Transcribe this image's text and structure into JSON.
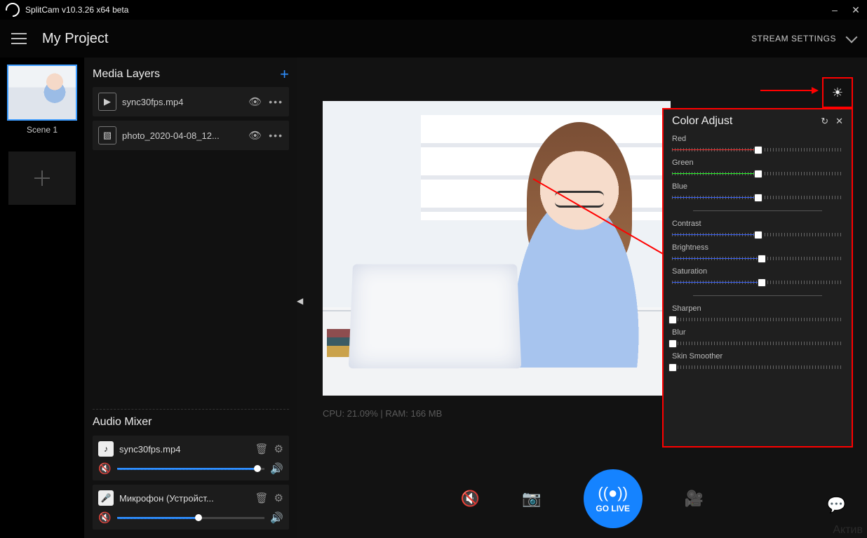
{
  "app": {
    "title": "SplitCam v10.3.26 x64 beta"
  },
  "header": {
    "project_name": "My Project",
    "stream_settings": "STREAM SETTINGS"
  },
  "scenes": {
    "item1_label": "Scene 1"
  },
  "layers": {
    "title": "Media Layers",
    "items": [
      {
        "name": "sync30fps.mp4",
        "icon": "▶"
      },
      {
        "name": "photo_2020-04-08_12...",
        "icon": "▧"
      }
    ]
  },
  "mixer": {
    "title": "Audio Mixer",
    "items": [
      {
        "name": "sync30fps.mp4",
        "vol_percent": 95
      },
      {
        "name": "Микрофон (Устройст...",
        "vol_percent": 55
      }
    ]
  },
  "stats": {
    "text": "CPU: 21.09% | RAM: 166 MB"
  },
  "golive": {
    "label": "GO LIVE"
  },
  "adjust": {
    "title": "Color Adjust",
    "sliders": {
      "red": {
        "label": "Red",
        "pos": 50,
        "color": "#ff2a2a"
      },
      "green": {
        "label": "Green",
        "pos": 50,
        "color": "#29ff29"
      },
      "blue": {
        "label": "Blue",
        "pos": 50,
        "color": "#3a63ff"
      },
      "contrast": {
        "label": "Contrast",
        "pos": 50,
        "color": "#3a63ff"
      },
      "brightness": {
        "label": "Brightness",
        "pos": 52,
        "color": "#3a63ff"
      },
      "saturation": {
        "label": "Saturation",
        "pos": 52,
        "color": "#3a63ff"
      },
      "sharpen": {
        "label": "Sharpen",
        "pos": 0,
        "color": "#3a63ff"
      },
      "blur": {
        "label": "Blur",
        "pos": 0,
        "color": "#3a63ff"
      },
      "smoother": {
        "label": "Skin Smoother",
        "pos": 0,
        "color": "#3a63ff"
      }
    }
  },
  "watermark": {
    "text": "Актив"
  }
}
